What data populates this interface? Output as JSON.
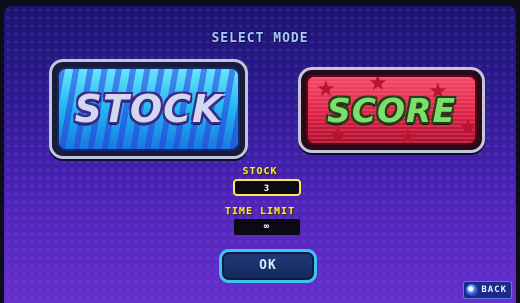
{
  "title": "SELECT MODE",
  "modes": {
    "stock": {
      "label": "STOCK"
    },
    "score": {
      "label": "SCORE"
    }
  },
  "settings": {
    "stock_label": "STOCK",
    "stock_value": "3",
    "time_limit_label": "TIME LIMIT",
    "time_limit_value": "∞"
  },
  "ok_label": "OK",
  "back_label": "BACK",
  "colors": {
    "stock_card": "#22b6f0",
    "score_card": "#d81e44",
    "highlight": "#ffe84a",
    "ok_border": "#3ec4f0"
  },
  "icons": {
    "back": "button-icon"
  }
}
